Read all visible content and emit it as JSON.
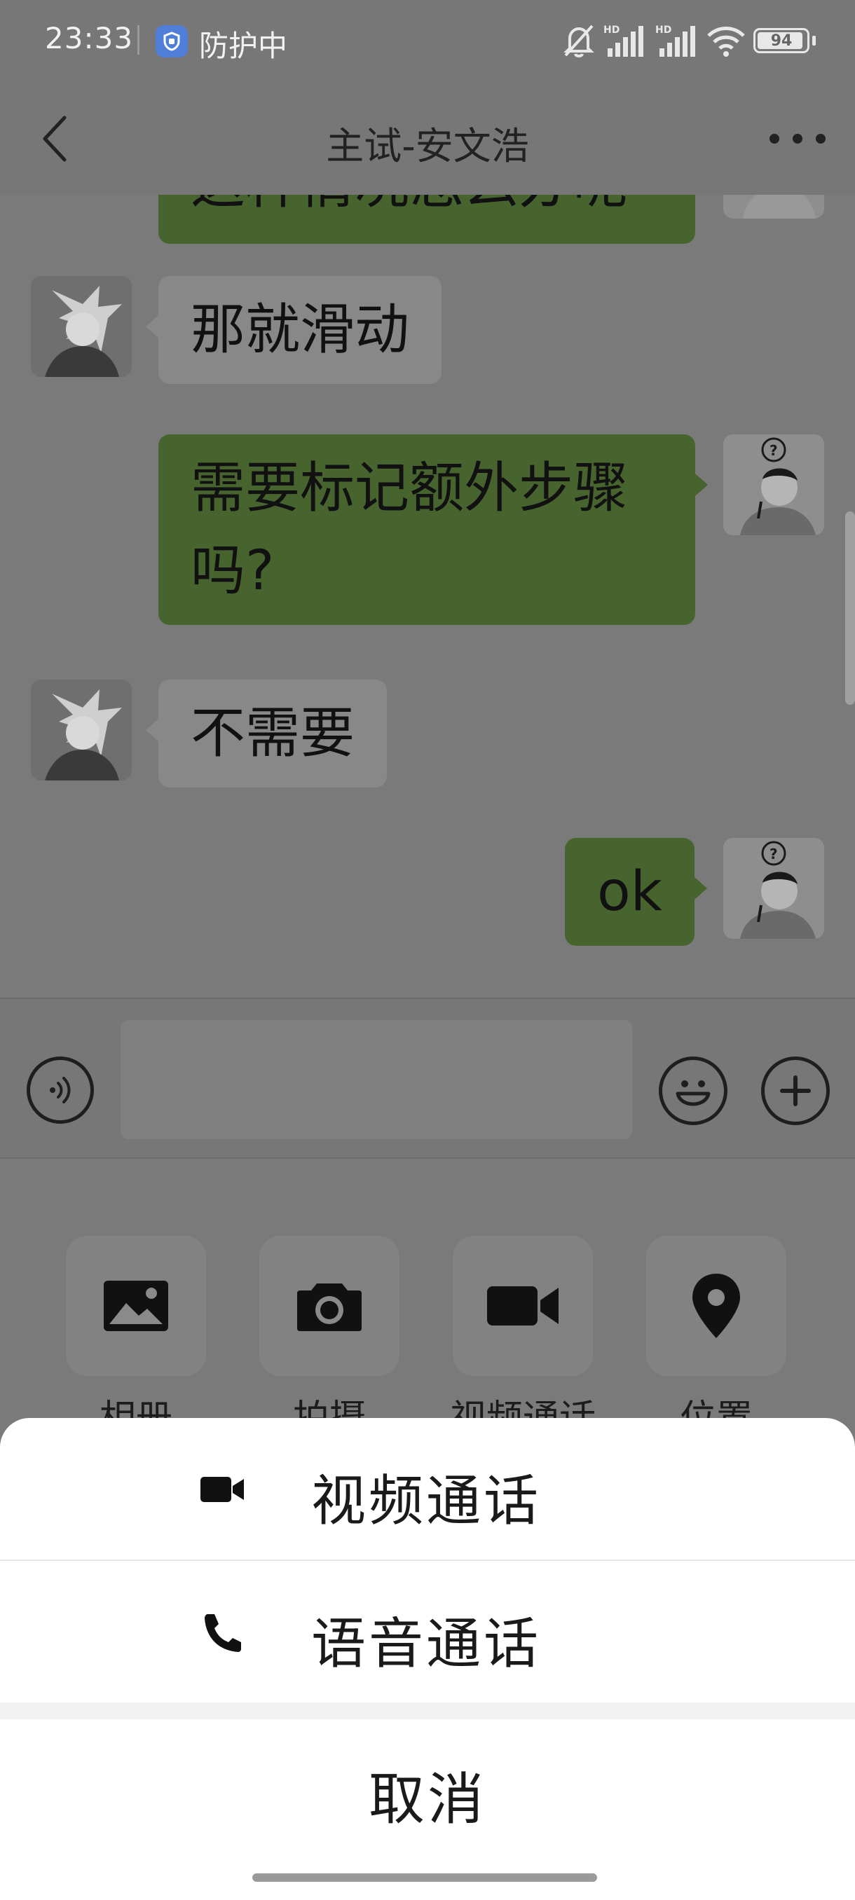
{
  "status_bar": {
    "time": "23:33",
    "app_label": "防护中",
    "battery_level": 94,
    "battery_text": "94",
    "icons": [
      "shield-icon",
      "bell-muted-icon",
      "hd-signal-icon",
      "hd-signal-icon",
      "wifi-icon",
      "battery-icon"
    ],
    "signal_badge": "HD"
  },
  "nav": {
    "title": "主试-安文浩"
  },
  "messages": [
    {
      "side": "right",
      "text": "这种情况怎么办呢"
    },
    {
      "side": "left",
      "text": "那就滑动"
    },
    {
      "side": "right",
      "text": "需要标记额外步骤吗?"
    },
    {
      "side": "left",
      "text": "不需要"
    },
    {
      "side": "right",
      "text": "ok"
    }
  ],
  "input": {
    "placeholder": ""
  },
  "panel": {
    "items": [
      {
        "label": "相册",
        "icon": "image-icon"
      },
      {
        "label": "拍摄",
        "icon": "camera-icon"
      },
      {
        "label": "视频通话",
        "icon": "video-camera-icon"
      },
      {
        "label": "位置",
        "icon": "location-pin-icon"
      }
    ]
  },
  "sheet": {
    "video_call": "视频通话",
    "voice_call": "语音通话",
    "cancel": "取消"
  },
  "colors": {
    "sent_bubble": "#47642f",
    "received_bubble": "#888888",
    "sheet_background": "#ffffff",
    "overlay": "#7a7a7a"
  }
}
